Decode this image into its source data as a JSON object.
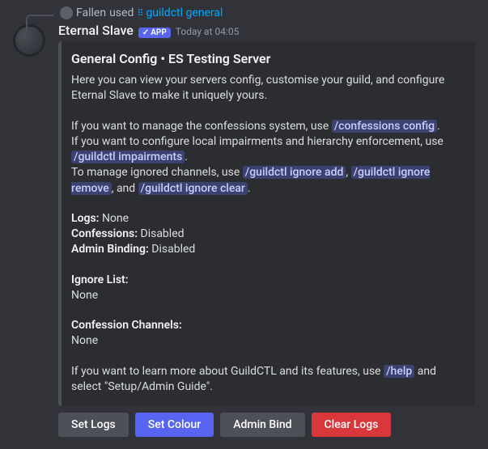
{
  "reply": {
    "user": "Fallen",
    "used_text": "used",
    "command": "guildctl general"
  },
  "message": {
    "author": "Eternal Slave",
    "app_badge": "APP",
    "timestamp": "Today at 04:05"
  },
  "embed": {
    "title": "General Config • ES Testing Server",
    "intro": "Here you can view your servers config, customise your guild, and configure Eternal Slave to make it uniquely yours.",
    "line_confessions_pre": "If you want to manage the confessions system, use ",
    "cmd_confessions": "/confessions config",
    "line_impairments_pre": "If you want to configure local impairments and hierarchy enforcement, use ",
    "cmd_impairments": "/guildctl impairments",
    "line_ignored_pre": "To manage ignored channels, use ",
    "cmd_ignore_add": "/guildctl ignore add",
    "sep_comma": ", ",
    "cmd_ignore_remove": "/guildctl ignore remove",
    "sep_and": ", and ",
    "cmd_ignore_clear": "/guildctl ignore clear",
    "period": ".",
    "logs_label": "Logs:",
    "logs_value": " None",
    "confessions_label": "Confessions:",
    "confessions_value": " Disabled",
    "admin_binding_label": "Admin Binding:",
    "admin_binding_value": " Disabled",
    "ignore_list_label": "Ignore List:",
    "ignore_list_value": "None",
    "confession_channels_label": "Confession Channels:",
    "confession_channels_value": "None",
    "learn_pre": "If you want to learn more about GuildCTL and its features, use ",
    "cmd_help": "/help",
    "learn_post": " and select \"Setup/Admin Guide\"."
  },
  "buttons": {
    "set_logs": "Set Logs",
    "set_colour": "Set Colour",
    "admin_bind": "Admin Bind",
    "clear_logs": "Clear Logs"
  }
}
